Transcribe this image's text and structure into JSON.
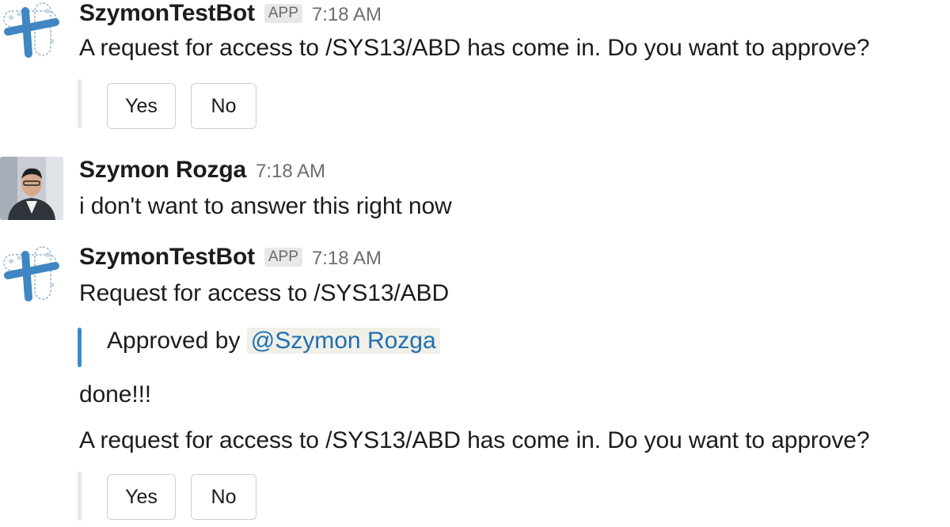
{
  "messages": [
    {
      "sender": "SzymonTestBot",
      "badge": "APP",
      "time": "7:18 AM",
      "text": "A request for access to /SYS13/ABD has come in. Do you want to approve?",
      "buttons": [
        "Yes",
        "No"
      ]
    },
    {
      "sender": "Szymon Rozga",
      "time": "7:18 AM",
      "text": "i don't want to answer this right now"
    },
    {
      "sender": "SzymonTestBot",
      "badge": "APP",
      "time": "7:18 AM",
      "text": "Request for access to /SYS13/ABD",
      "attachment": {
        "prefix": "Approved by",
        "mention": "@Szymon Rozga"
      },
      "followups": [
        "done!!!",
        "A request for access to /SYS13/ABD has come in. Do you want to approve?"
      ],
      "buttons": [
        "Yes",
        "No"
      ]
    }
  ],
  "colors": {
    "attachment_bar_approved": "#3b8bc9",
    "attachment_bar_default": "#e8e8e8",
    "mention": "#1f6fb2",
    "bot_logo": "#3f86c2"
  },
  "icons": {
    "bot_avatar": "bot-logo-icon",
    "user_avatar": "user-photo"
  }
}
